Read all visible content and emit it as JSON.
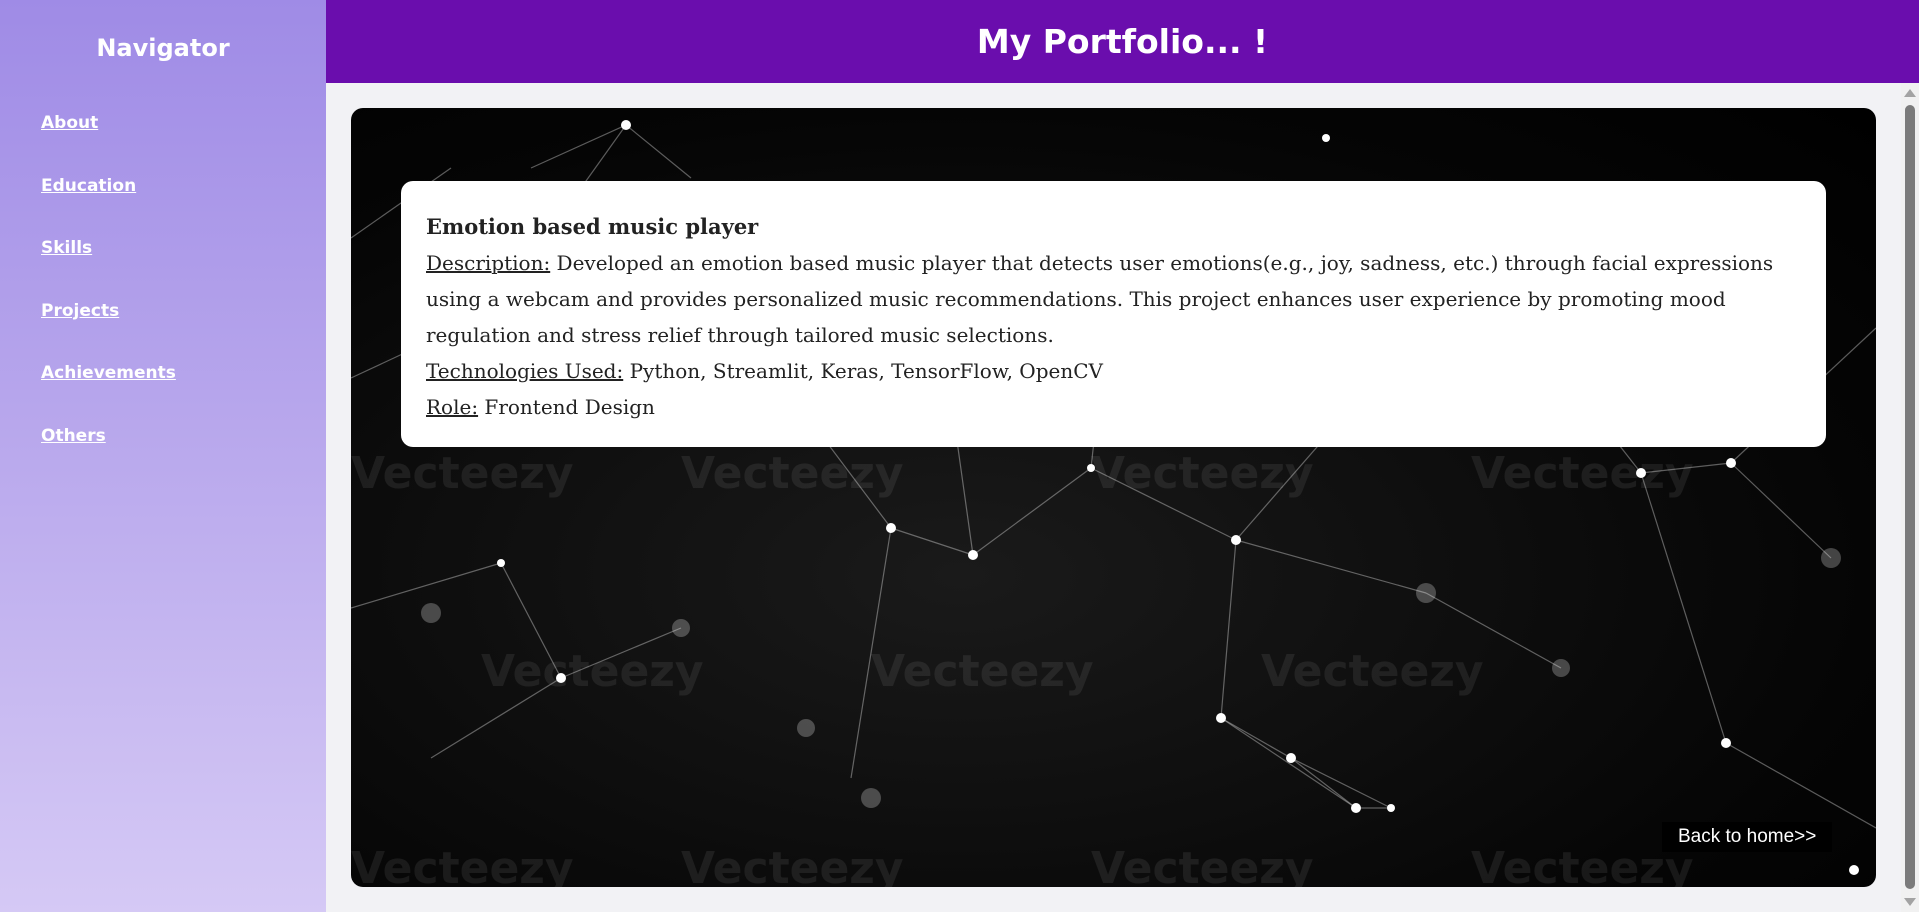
{
  "sidebar": {
    "title": "Navigator",
    "items": [
      {
        "label": "About"
      },
      {
        "label": "Education"
      },
      {
        "label": "Skills"
      },
      {
        "label": "Projects"
      },
      {
        "label": "Achievements"
      },
      {
        "label": "Others"
      }
    ]
  },
  "header": {
    "title": "My Portfolio... !"
  },
  "project": {
    "title": "Emotion based music player",
    "description_label": "Description:",
    "description": " Developed an emotion based music player that detects user emotions(e.g., joy, sadness, etc.) through facial expressions using a webcam and provides personalized music recommendations. This project enhances user experience by promoting mood regulation and stress relief through tailored music selections.",
    "technologies_label": "Technologies Used:",
    "technologies": " Python, Streamlit, Keras, TensorFlow, OpenCV",
    "role_label": "Role:",
    "role": " Frontend Design"
  },
  "hero": {
    "watermark_text": "Vecteezy"
  },
  "footer": {
    "back_link": "Back to home>>"
  },
  "colors": {
    "header_bg": "#6a0dad",
    "sidebar_top": "#9f8be6",
    "sidebar_bottom": "#d5c9f5"
  }
}
